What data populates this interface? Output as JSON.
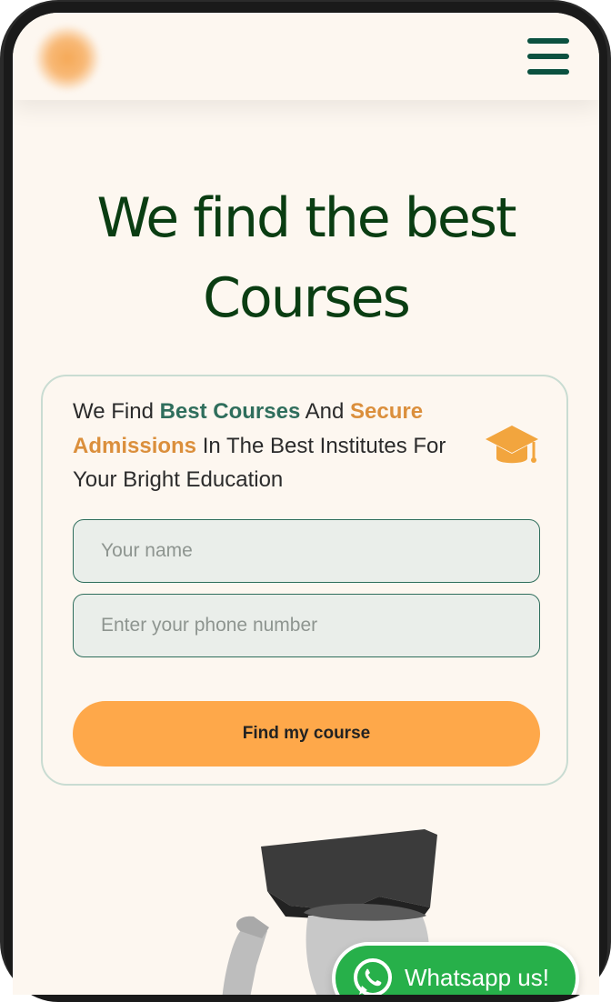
{
  "header": {
    "logo_icon": "logo-blob",
    "menu_icon": "hamburger-menu-icon"
  },
  "hero": {
    "title_line1": "We find the best",
    "title_line2": "Courses"
  },
  "card": {
    "text_part1": "We Find ",
    "text_highlight1": "Best Courses",
    "text_part2": " And ",
    "text_highlight2": "Secure Admissions",
    "text_part3": " In The Best Institutes For Your Bright Education",
    "icon": "graduation-cap-icon",
    "name_placeholder": "Your name",
    "phone_placeholder": "Enter your phone number",
    "submit_label": "Find my course"
  },
  "whatsapp": {
    "label": "Whatsapp us!",
    "icon": "whatsapp-icon"
  },
  "colors": {
    "background": "#fdf7f0",
    "title": "#0a3d12",
    "accent_green": "#2f6e5c",
    "accent_orange": "#db8f3c",
    "button_orange": "#fea84a",
    "menu_icon": "#0b5140",
    "whatsapp_green": "#27b04a"
  }
}
